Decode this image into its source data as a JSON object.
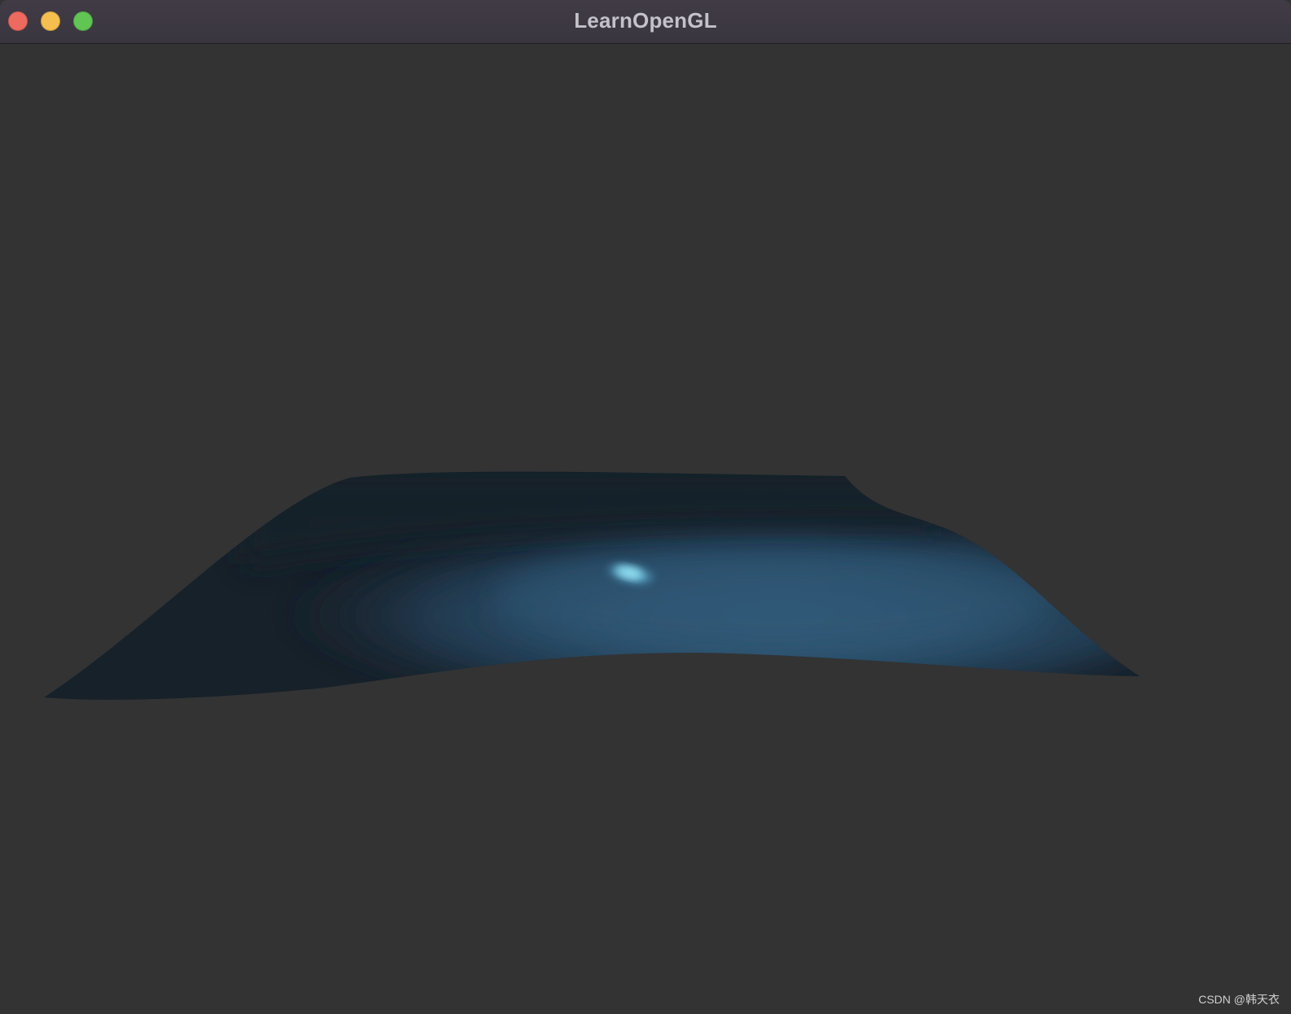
{
  "window": {
    "title": "LearnOpenGL",
    "buttons": {
      "close_color": "#ee6a5f",
      "minimize_color": "#f5bf4f",
      "zoom_color": "#61c554"
    }
  },
  "scene": {
    "clear_color": "#333333",
    "surface_shadow_color": "#17212a",
    "surface_lit_color": "#2e5470",
    "specular_color": "#8fdcf0"
  },
  "watermark": {
    "text": "CSDN @韩天衣"
  }
}
